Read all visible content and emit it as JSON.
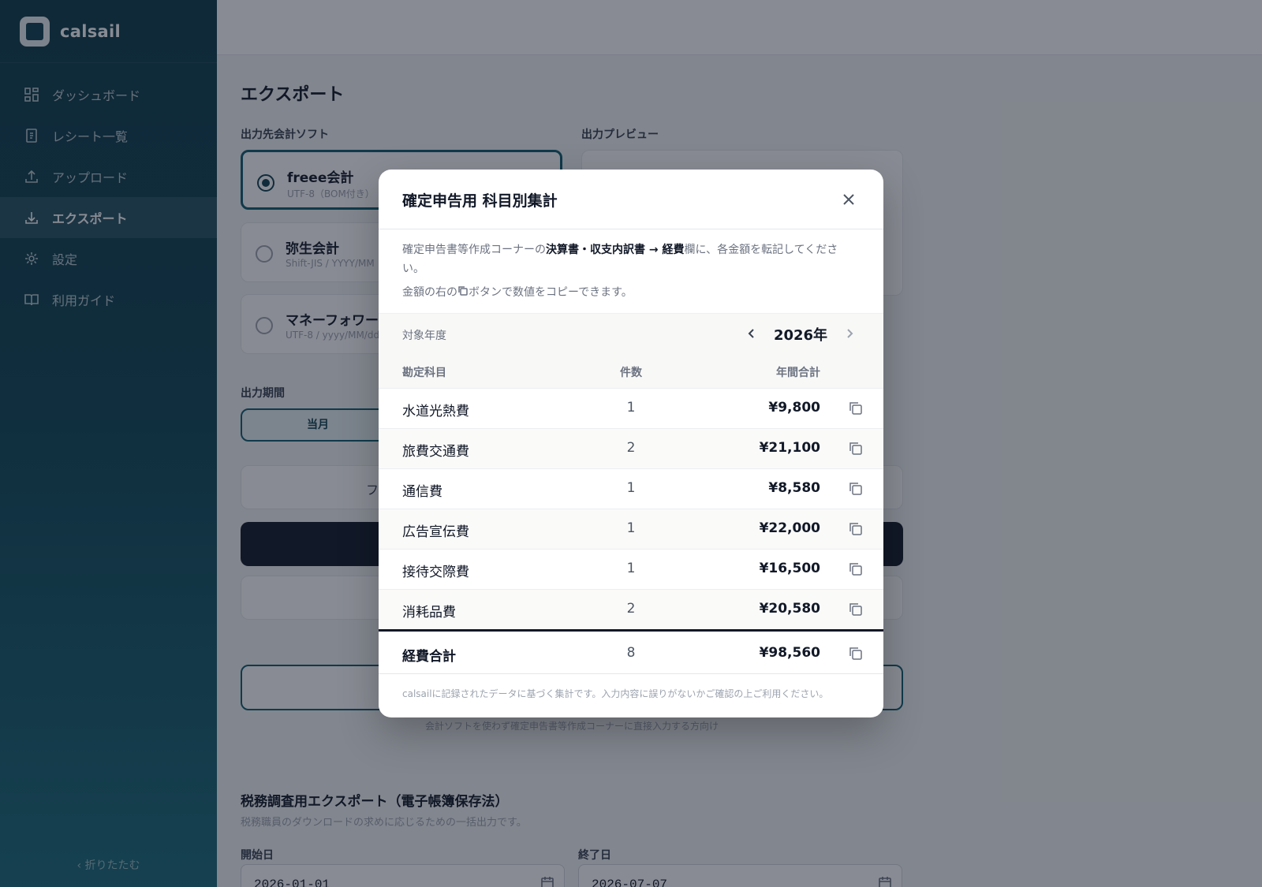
{
  "app": {
    "name": "calsail"
  },
  "sidebar": {
    "items": [
      {
        "label": "ダッシュボード",
        "icon": "dashboard-icon"
      },
      {
        "label": "レシート一覧",
        "icon": "receipt-icon"
      },
      {
        "label": "アップロード",
        "icon": "upload-icon"
      },
      {
        "label": "エクスポート",
        "icon": "download-icon",
        "active": true
      },
      {
        "label": "設定",
        "icon": "gear-icon"
      },
      {
        "label": "利用ガイド",
        "icon": "book-icon"
      }
    ],
    "collapse_label": "‹ 折りたたむ"
  },
  "page": {
    "title": "エクスポート",
    "software_label": "出力先会計ソフト",
    "preview_label": "出力プレビュー",
    "software_options": [
      {
        "name": "freee会計",
        "meta": "UTF-8（BOM付き）",
        "selected": true
      },
      {
        "name": "弥生会計",
        "meta": "Shift-JIS / YYYY/MM",
        "selected": false
      },
      {
        "name": "マネーフォワー",
        "meta": "UTF-8 / yyyy/MM/dd",
        "selected": false
      }
    ],
    "period_label": "出力期間",
    "period_current": "当月",
    "partial_button_char": "フ",
    "helper_text": "会計ソフトを使わず確定申告書等作成コーナーに直接入力する方向け",
    "tax_title": "税務調査用エクスポート（電子帳簿保存法）",
    "tax_sub": "税務職員のダウンロードの求めに応じるための一括出力です。",
    "start_label": "開始日",
    "start_value": "2026-01-01",
    "end_label": "終了日",
    "end_value": "2026-07-07"
  },
  "modal": {
    "title": "確定申告用 科目別集計",
    "desc_prefix": "確定申告書等作成コーナーの",
    "desc_bold": "決算書・収支内訳書 → 経費",
    "desc_suffix": "欄に、各金額を転記してください。",
    "desc_line2_prefix": "金額の右の",
    "desc_line2_suffix": "ボタンで数値をコピーできます。",
    "year_label": "対象年度",
    "year_value": "2026年",
    "columns": {
      "account": "勘定科目",
      "count": "件数",
      "total": "年間合計"
    },
    "rows": [
      {
        "account": "水道光熱費",
        "count": "1",
        "total": "¥9,800"
      },
      {
        "account": "旅費交通費",
        "count": "2",
        "total": "¥21,100"
      },
      {
        "account": "通信費",
        "count": "1",
        "total": "¥8,580"
      },
      {
        "account": "広告宣伝費",
        "count": "1",
        "total": "¥22,000"
      },
      {
        "account": "接待交際費",
        "count": "1",
        "total": "¥16,500"
      },
      {
        "account": "消耗品費",
        "count": "2",
        "total": "¥20,580"
      }
    ],
    "total_row": {
      "account": "経費合計",
      "count": "8",
      "total": "¥98,560"
    },
    "footer": "calsailに記録されたデータに基づく集計です。入力内容に誤りがないかご確認の上ご利用ください。"
  },
  "colors": {
    "sidebar": "#0e4453",
    "accent": "#0f5d6e",
    "dark_button": "#111827"
  }
}
